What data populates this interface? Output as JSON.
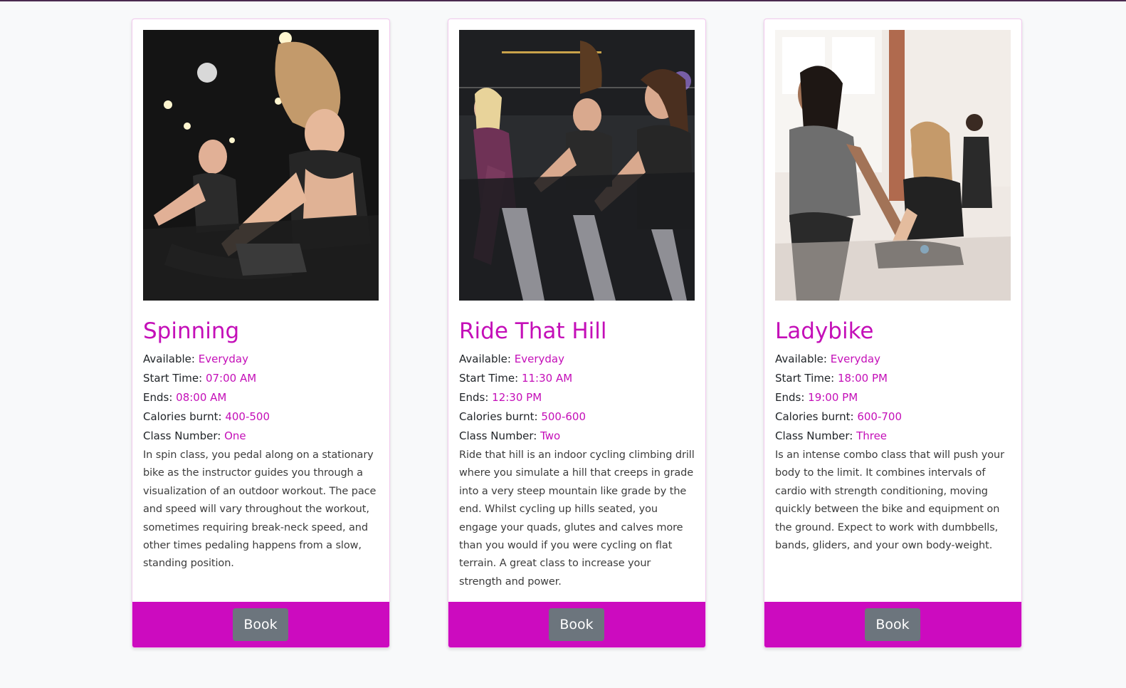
{
  "colors": {
    "accent": "#c40fb8",
    "footer": "#cc0bbf",
    "button": "#6c757d",
    "background": "#f8f9fa"
  },
  "labels": {
    "available": "Available:",
    "start_time": "Start Time:",
    "ends": "Ends:",
    "calories": "Calories burnt:",
    "class_number": "Class Number:"
  },
  "classes": [
    {
      "title": "Spinning",
      "available": "Everyday",
      "start_time": "07:00 AM",
      "ends": "08:00 AM",
      "calories": "400-500",
      "class_number": "One",
      "description": "In spin class, you pedal along on a stationary bike as the instructor guides you through a visualization of an outdoor workout. The pace and speed will vary throughout the workout, sometimes requiring break-neck speed, and other times pedaling happens from a slow, standing position.",
      "button_label": "Book"
    },
    {
      "title": "Ride That Hill",
      "available": "Everyday",
      "start_time": "11:30 AM",
      "ends": "12:30 PM",
      "calories": "500-600",
      "class_number": "Two",
      "description": "Ride that hill is an indoor cycling climbing drill where you simulate a hill that creeps in grade into a very steep mountain like grade by the end. Whilst cycling up hills seated, you engage your quads, glutes and calves more than you would if you were cycling on flat terrain. A great class to increase your strength and power.",
      "button_label": "Book"
    },
    {
      "title": "Ladybike",
      "available": "Everyday",
      "start_time": "18:00 PM",
      "ends": "19:00 PM",
      "calories": "600-700",
      "class_number": "Three",
      "description": "Is an intense combo class that will push your body to the limit. It combines intervals of cardio with strength conditioning, moving quickly between the bike and equipment on the ground. Expect to work with dumbbells, bands, gliders, and your own body-weight.",
      "button_label": "Book"
    }
  ]
}
